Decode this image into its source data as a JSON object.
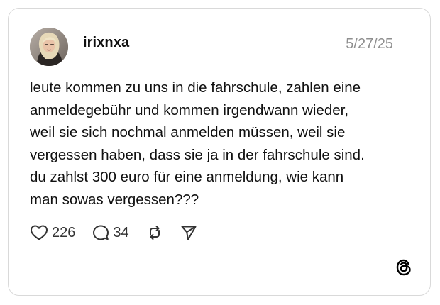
{
  "post": {
    "username": "irixnxa",
    "date": "5/27/25",
    "text_lines": [
      "leute kommen zu uns in die fahrschule, zahlen eine",
      "anmeldegebühr und kommen irgendwann wieder,",
      "weil sie sich nochmal anmelden müssen, weil sie",
      "vergessen haben, dass sie ja in der fahrschule sind.",
      "du zahlst 300 euro für eine anmeldung, wie kann",
      "man sowas vergessen???"
    ],
    "likes": "226",
    "replies": "34"
  },
  "icons": {
    "like": "heart-icon",
    "reply": "speech-bubble-icon",
    "repost": "repost-icon",
    "share": "send-icon",
    "brand": "threads-logo-icon"
  },
  "colors": {
    "border": "#d9d9d9",
    "text": "#101010",
    "muted": "#8f8f8f",
    "icon": "#333333"
  }
}
